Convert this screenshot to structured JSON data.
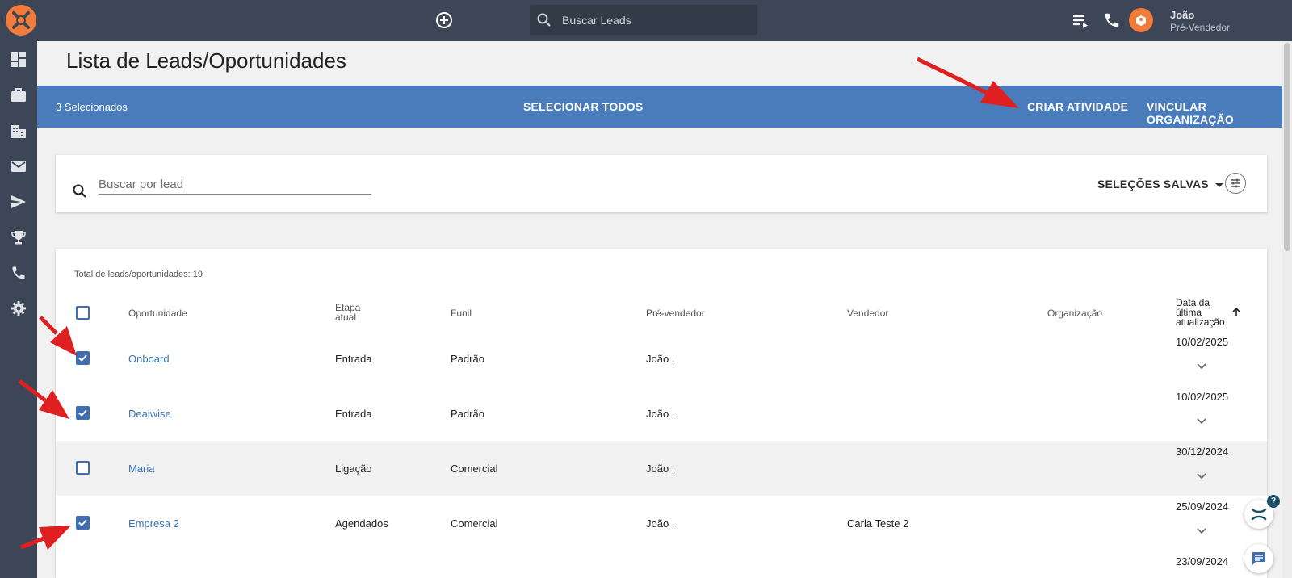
{
  "topbar": {
    "search_placeholder": "Buscar Leads",
    "user_name": "João",
    "user_role": "Pré-Vendedor"
  },
  "sidenav": {
    "items": [
      "dashboard-icon",
      "briefcase-icon",
      "building-icon",
      "mail-icon",
      "send-icon",
      "trophy-icon",
      "phone-icon",
      "gear-icon"
    ]
  },
  "page": {
    "title": "Lista de Leads/Oportunidades"
  },
  "selection_bar": {
    "count_label": "3 Selecionados",
    "select_all": "SELECIONAR TODOS",
    "create_activity": "CRIAR ATIVIDADE",
    "link_org": "VINCULAR ORGANIZAÇÃO"
  },
  "filters": {
    "search_placeholder": "Buscar por lead",
    "saved_selections": "SELEÇÕES SALVAS"
  },
  "table": {
    "total_label": "Total de leads/oportunidades: 19",
    "headers": {
      "opportunity": "Oportunidade",
      "stage_line1": "Etapa",
      "stage_line2": "atual",
      "funnel": "Funil",
      "presales": "Pré-vendedor",
      "seller": "Vendedor",
      "organization": "Organização",
      "date_line1": "Data da",
      "date_line2": "última",
      "date_line3": "atualização"
    },
    "rows": [
      {
        "checked": true,
        "opportunity": "Onboard",
        "stage": "Entrada",
        "funnel": "Padrão",
        "presales": "João .",
        "seller": "",
        "organization": "",
        "date": "10/02/2025"
      },
      {
        "checked": true,
        "opportunity": "Dealwise",
        "stage": "Entrada",
        "funnel": "Padrão",
        "presales": "João .",
        "seller": "",
        "organization": "",
        "date": "10/02/2025"
      },
      {
        "checked": false,
        "opportunity": "Maria",
        "stage": "Ligação",
        "funnel": "Comercial",
        "presales": "João .",
        "seller": "",
        "organization": "",
        "date": "30/12/2024"
      },
      {
        "checked": true,
        "opportunity": "Empresa 2",
        "stage": "Agendados",
        "funnel": "Comercial",
        "presales": "João .",
        "seller": "Carla Teste 2",
        "organization": "",
        "date": "25/09/2024"
      },
      {
        "checked": false,
        "opportunity": "",
        "stage": "",
        "funnel": "",
        "presales": "",
        "seller": "",
        "organization": "",
        "date": "23/09/2024"
      }
    ]
  },
  "help": {
    "badge": "?"
  },
  "colors": {
    "topbar": "#3c4656",
    "accent": "#4a7cbb",
    "brand": "#f07b3a",
    "annotation_arrow": "#e02020"
  }
}
